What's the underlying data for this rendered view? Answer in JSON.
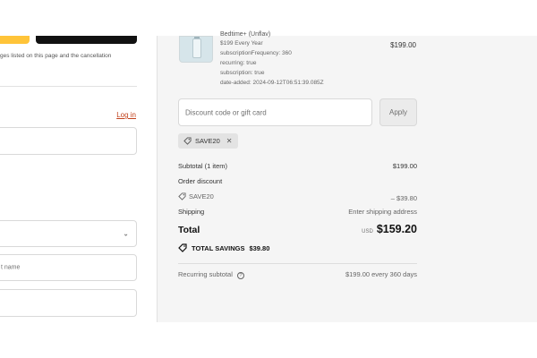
{
  "left": {
    "disclaimer": "ges listed on this page and the cancellation",
    "login_link": "Log in",
    "email_field": {
      "value": ""
    },
    "country_select": {
      "value": ""
    },
    "last_name_field": {
      "placeholder": "t name"
    },
    "address_field": {
      "value": ""
    }
  },
  "product": {
    "name_fragment": "Bedtime+ (Unflav)",
    "meta": [
      "$199 Every Year",
      "subscriptionFrequency: 360",
      "recurring: true",
      "subscription: true",
      "date-added: 2024-09-12T06:51:39.085Z"
    ],
    "price": "$199.00"
  },
  "discount": {
    "placeholder": "Discount code or gift card",
    "apply_label": "Apply",
    "applied_code": "SAVE20",
    "remove_icon": "close-icon"
  },
  "summary": {
    "subtotal_label": "Subtotal (1 item)",
    "subtotal_value": "$199.00",
    "order_discount_label": "Order discount",
    "discount_code": "SAVE20",
    "discount_value": "– $39.80",
    "shipping_label": "Shipping",
    "shipping_value": "Enter shipping address",
    "total_label": "Total",
    "currency": "USD",
    "total_value": "$159.20",
    "savings_label": "TOTAL SAVINGS",
    "savings_value": "$39.80",
    "recurring_label": "Recurring subtotal",
    "recurring_value": "$199.00 every 360 days"
  },
  "colors": {
    "accent_link": "#c2411b",
    "express_yellow": "#ffc439",
    "express_black": "#111111",
    "summary_bg": "#f5f5f5"
  }
}
